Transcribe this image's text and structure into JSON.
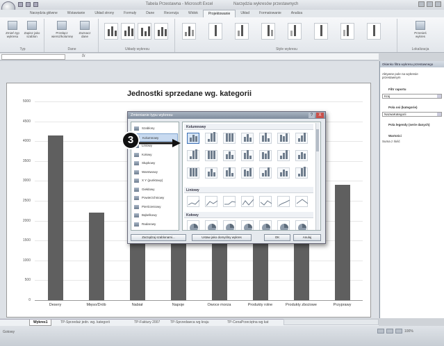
{
  "window": {
    "title_parts": [
      "Tabela Przestawna - Microsoft Excel",
      "Narzędzia wykresów przestawnych"
    ]
  },
  "ribbon": {
    "tabs": [
      "Narzędzia główne",
      "Wstawianie",
      "Układ strony",
      "Formuły",
      "Dane",
      "Recenzja",
      "Widok",
      "Projektowanie",
      "Układ",
      "Formatowanie",
      "Analiza"
    ],
    "active_tab": "Projektowanie",
    "groups": {
      "typ": {
        "label": "Typ",
        "buttons": [
          "Zmień typ wykresu",
          "Zapisz jako szablon"
        ]
      },
      "dane": {
        "label": "Dane",
        "buttons": [
          "Przełącz wiersz/kolumnę",
          "Zaznacz dane"
        ]
      },
      "uklady": {
        "label": "Układy wykresu"
      },
      "style": {
        "label": "Style wykresu"
      },
      "lokalizacja": {
        "label": "Lokalizacja",
        "button": "Przenieś wykres"
      }
    }
  },
  "formula_bar": {
    "fx": "fx"
  },
  "chart_data": {
    "type": "bar",
    "title": "Jednostki sprzedane wg. kategorii",
    "categories": [
      "Desery",
      "Mięso/Drób",
      "Nabiał",
      "Napoje",
      "Owoce morza",
      "Produkty rolne",
      "Produkty zbożowe",
      "Przyprawy"
    ],
    "values": [
      4150,
      2200,
      3000,
      3050,
      2800,
      2050,
      2300,
      2900
    ],
    "ylim": [
      0,
      5000
    ],
    "yticks": [
      0,
      500,
      1000,
      1500,
      2000,
      2500,
      3000,
      3500,
      4000,
      4500,
      5000
    ],
    "grid": true,
    "colors": [
      "#5f5f5f"
    ]
  },
  "dialog": {
    "title": "Zmienianie typu wykresu",
    "help": "?",
    "close": "X",
    "types": [
      "Szablony",
      "Kolumnowy",
      "Liniowy",
      "Kołowy",
      "Słupkowy",
      "Warstwowy",
      "X Y (punktowy)",
      "Giełdowy",
      "Powierzchniowy",
      "Pierścieniowy",
      "Bąbelkowy",
      "Radarowy"
    ],
    "selected_type": "Kolumnowy",
    "sections": [
      "Kolumnowy",
      "Liniowy",
      "Kołowy"
    ],
    "buttons": {
      "manage": "Zarządzaj szablonami...",
      "set_default": "Ustaw jako domyślny wykres",
      "ok": "OK",
      "cancel": "Anuluj"
    }
  },
  "callout": {
    "number": "3"
  },
  "task_pane": {
    "title": "Okienko filtra wykresu przestawnego",
    "subtitle": "Aktywne pole na wykresie przestawnym",
    "filter_label": "Filtr raportu",
    "filter_value": "Kraj",
    "axis_label": "Pola osi (kategorie)",
    "axis_value": "NazwaKategorii",
    "legend_label": "Pola legendy (serie danych)",
    "values_label": "Wartości",
    "values_value": "Suma z Ilość"
  },
  "sheet_tabs": [
    "Wykres1",
    "TP-Sprzedaż jedn. wg. kategorii",
    "TP-Faktury 2007",
    "TP-Sprzedawca wg kraju",
    "TP-CenaPrzeciętna wg kat"
  ],
  "active_sheet": "Wykres1",
  "status": {
    "left": "Gotowy",
    "zoom": "100%"
  }
}
